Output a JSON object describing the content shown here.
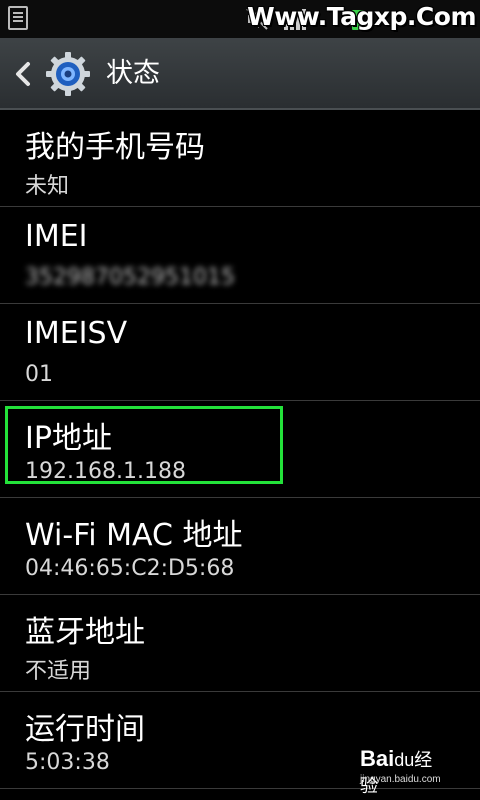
{
  "status_bar": {
    "watermark": "Www.Tagxp.Com",
    "icons": [
      "sim-icon",
      "mute-icon",
      "signal-icon",
      "battery-icon"
    ]
  },
  "header": {
    "title": "状态",
    "icon": "gear-icon"
  },
  "rows": [
    {
      "label": "我的手机号码",
      "value": "未知"
    },
    {
      "label": "IMEI",
      "value": "352987052951015"
    },
    {
      "label": "IMEISV",
      "value": "01"
    },
    {
      "label": "IP地址",
      "value": "192.168.1.188"
    },
    {
      "label": "Wi-Fi MAC 地址",
      "value": "04:46:65:C2:D5:68"
    },
    {
      "label": "蓝牙地址",
      "value": "不适用"
    },
    {
      "label": "运行时间",
      "value": "5:03:38"
    }
  ],
  "footer_watermark": {
    "brand": "Bai",
    "paw": "du",
    "jingyan": "经验",
    "url": "jingyan.baidu.com"
  },
  "colors": {
    "highlight": "#23e23a",
    "actionbar": "#3e4346"
  }
}
